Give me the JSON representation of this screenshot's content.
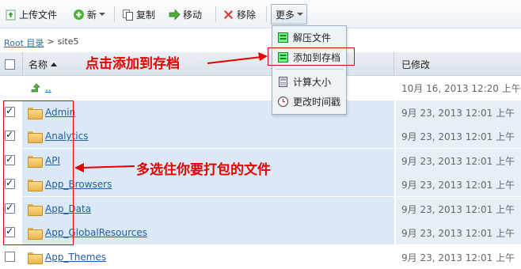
{
  "toolbar": {
    "upload": "上传文件",
    "new": "新",
    "copy": "复制",
    "move": "移动",
    "remove": "移除",
    "more": "更多"
  },
  "breadcrumb": {
    "root": "Root 目录",
    "sep": ">",
    "current": "site5"
  },
  "table": {
    "col_name": "名称",
    "col_modified": "已修改",
    "parent_link": "..",
    "parent_modified": "10月 16, 2013 12:20 上午",
    "rows": [
      {
        "name": "Admin",
        "modified": "9月 23, 2013 12:01 上午",
        "checked": true
      },
      {
        "name": "Analytics",
        "modified": "9月 23, 2013 12:01 上午",
        "checked": true
      },
      {
        "name": "API",
        "modified": "9月 23, 2013 12:01 上午",
        "checked": true
      },
      {
        "name": "App_Browsers",
        "modified": "9月 23, 2013 12:01 上午",
        "checked": true
      },
      {
        "name": "App_Data",
        "modified": "9月 23, 2013 12:01 上午",
        "checked": true
      },
      {
        "name": "App_GlobalResources",
        "modified": "9月 23, 2013 12:01 上午",
        "checked": true
      },
      {
        "name": "App_Themes",
        "modified": "9月 23, 2013 12:01 上午",
        "checked": false
      }
    ]
  },
  "menu": {
    "extract": "解压文件",
    "add_archive": "添加到存档",
    "calc_size": "计算大小",
    "change_time": "更改时间戳"
  },
  "annotations": {
    "click_add": "点击添加到存档",
    "multi_select": "多选住你要打包的文件",
    "color": "#e60000"
  }
}
